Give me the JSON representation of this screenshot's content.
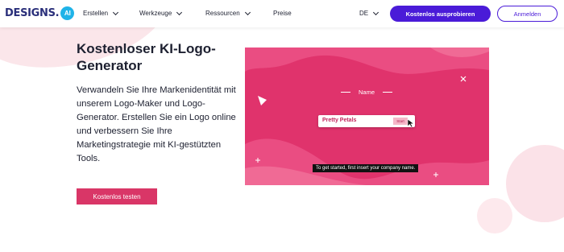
{
  "nav": {
    "logo_text": "DESIGNS.",
    "logo_badge": "AI",
    "items": [
      {
        "label": "Erstellen",
        "icon": "chevron-down-icon"
      },
      {
        "label": "Werkzeuge",
        "icon": "chevron-down-icon"
      },
      {
        "label": "Ressourcen",
        "icon": "chevron-down-icon"
      },
      {
        "label": "Preise"
      }
    ],
    "language": "DE",
    "primary_button": "Kostenlos ausprobieren",
    "login_button": "Anmelden"
  },
  "hero": {
    "title": "Kostenloser KI-Logo-Generator",
    "description": "Verwandeln Sie Ihre Markenidentität mit unserem Logo-Maker und Logo-Generator. Erstellen Sie ein Logo online und verbessern Sie Ihre Marketingstrategie mit KI-gestützten Tools.",
    "cta": "Kostenlos testen"
  },
  "video": {
    "field_label": "Name",
    "field_value": "Pretty Petals",
    "start_label": "Start",
    "caption": "To get started, first insert your company name."
  },
  "colors": {
    "brand_purple": "#4a1bd8",
    "cta_pink": "#d93667",
    "panel_pink": "#e0336c"
  }
}
